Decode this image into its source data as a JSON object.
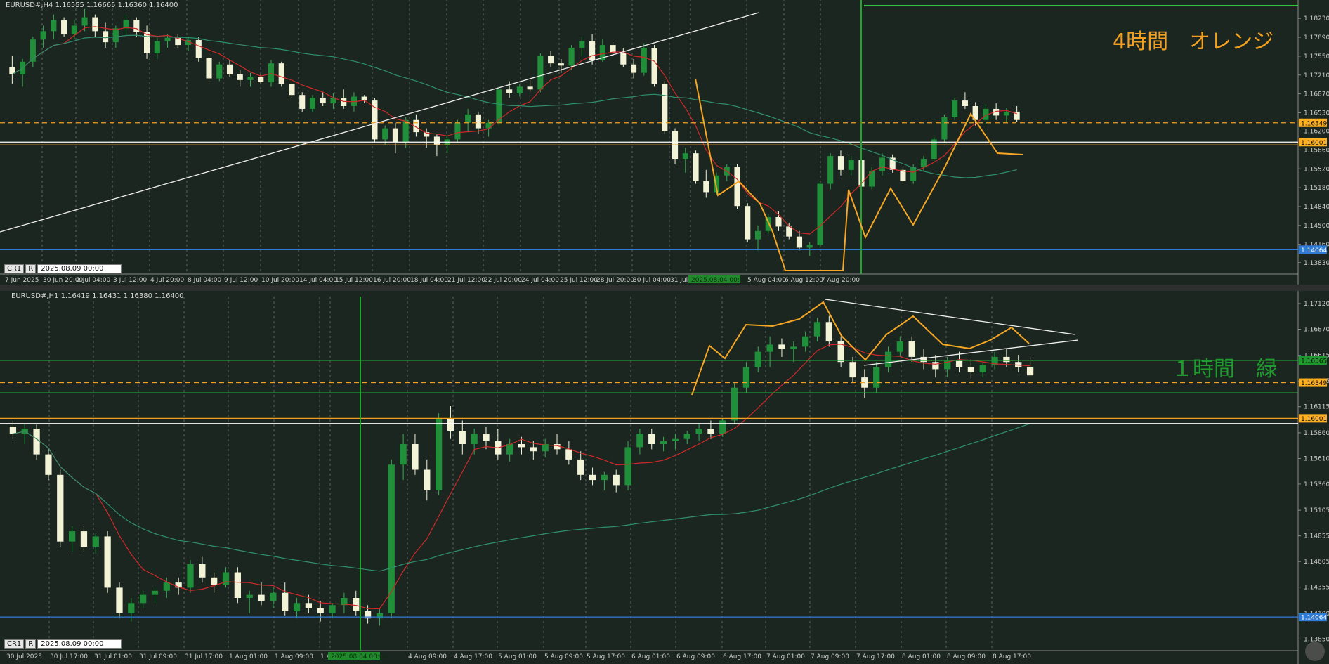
{
  "chart_data": [
    {
      "type": "candlestick",
      "symbol_header": "EURUSD#,H4  1.16555 1.16665 1.16360 1.16400",
      "title": "4時間　オレンジ",
      "cr_label": "CR1",
      "r_label": "R",
      "cursor_time": "2025.08.09 00:00",
      "x_ticks": [
        "7 Jun 2025",
        "30 Jun 20:00",
        "2 Jul 04:00",
        "3 Jul 12:00",
        "4 Jul 20:00",
        "8 Jul 04:00",
        "9 Jul 12:00",
        "10 Jul 20:00",
        "14 Jul 04:00",
        "15 Jul 12:00",
        "16 Jul 20:00",
        "18 Jul 04:00",
        "21 Jul 12:00",
        "22 Jul 20:00",
        "24 Jul 04:00",
        "25 Jul 12:00",
        "28 Jul 20:00",
        "30 Jul 04:00",
        "31 Jul 1",
        "2025.08.04 00:00",
        "5 Aug 04:00",
        "6 Aug 12:00",
        "7 Aug 20:00"
      ],
      "y_ticks": [
        "1.18230",
        "1.17890",
        "1.17550",
        "1.17210",
        "1.16870",
        "1.16530",
        "1.16200",
        "1.15860",
        "1.15520",
        "1.15180",
        "1.14840",
        "1.14500",
        "1.14160",
        "1.13830"
      ],
      "price_badges": [
        "1.16349",
        "1.16001",
        "1.14064"
      ],
      "ylim": [
        1.1365,
        1.1846
      ],
      "levels": [
        1.16349,
        1.16001,
        1.1595,
        1.14064
      ],
      "ohlc": [
        [
          1.1735,
          1.1755,
          1.1705,
          1.1722
        ],
        [
          1.1722,
          1.175,
          1.17,
          1.1745
        ],
        [
          1.1745,
          1.179,
          1.1735,
          1.1785
        ],
        [
          1.1785,
          1.181,
          1.177,
          1.18
        ],
        [
          1.18,
          1.183,
          1.1785,
          1.182
        ],
        [
          1.182,
          1.1825,
          1.179,
          1.1795
        ],
        [
          1.1795,
          1.182,
          1.1785,
          1.181
        ],
        [
          1.181,
          1.184,
          1.18,
          1.1825
        ],
        [
          1.1825,
          1.183,
          1.179,
          1.18
        ],
        [
          1.18,
          1.1815,
          1.177,
          1.178
        ],
        [
          1.178,
          1.181,
          1.177,
          1.1805
        ],
        [
          1.1805,
          1.183,
          1.1795,
          1.182
        ],
        [
          1.182,
          1.1825,
          1.179,
          1.1798
        ],
        [
          1.1798,
          1.181,
          1.175,
          1.176
        ],
        [
          1.176,
          1.179,
          1.175,
          1.1782
        ],
        [
          1.1782,
          1.1795,
          1.177,
          1.1788
        ],
        [
          1.1788,
          1.1795,
          1.177,
          1.1775
        ],
        [
          1.1775,
          1.179,
          1.1765,
          1.1784
        ],
        [
          1.1784,
          1.179,
          1.1745,
          1.1752
        ],
        [
          1.1752,
          1.176,
          1.1705,
          1.1715
        ],
        [
          1.1715,
          1.1745,
          1.171,
          1.174
        ],
        [
          1.174,
          1.1748,
          1.1718,
          1.1722
        ],
        [
          1.1722,
          1.173,
          1.17,
          1.1712
        ],
        [
          1.1712,
          1.1725,
          1.17,
          1.1718
        ],
        [
          1.1718,
          1.1722,
          1.1705,
          1.1708
        ],
        [
          1.1708,
          1.1748,
          1.17,
          1.1742
        ],
        [
          1.1742,
          1.1745,
          1.17,
          1.1705
        ],
        [
          1.1705,
          1.1712,
          1.168,
          1.1685
        ],
        [
          1.1685,
          1.169,
          1.1655,
          1.166
        ],
        [
          1.166,
          1.1685,
          1.1655,
          1.168
        ],
        [
          1.168,
          1.169,
          1.1665,
          1.167
        ],
        [
          1.167,
          1.1688,
          1.166,
          1.168
        ],
        [
          1.168,
          1.1695,
          1.166,
          1.1665
        ],
        [
          1.1665,
          1.169,
          1.1655,
          1.1682
        ],
        [
          1.1682,
          1.1685,
          1.167,
          1.1675
        ],
        [
          1.1675,
          1.168,
          1.16,
          1.1605
        ],
        [
          1.1605,
          1.163,
          1.1595,
          1.1625
        ],
        [
          1.1625,
          1.1635,
          1.158,
          1.16
        ],
        [
          1.16,
          1.1645,
          1.159,
          1.164
        ],
        [
          1.164,
          1.165,
          1.161,
          1.1618
        ],
        [
          1.1618,
          1.1625,
          1.159,
          1.161
        ],
        [
          1.161,
          1.1615,
          1.1575,
          1.1595
        ],
        [
          1.1595,
          1.161,
          1.158,
          1.1605
        ],
        [
          1.1605,
          1.164,
          1.16,
          1.1635
        ],
        [
          1.1635,
          1.166,
          1.162,
          1.165
        ],
        [
          1.165,
          1.1655,
          1.1615,
          1.1625
        ],
        [
          1.1625,
          1.164,
          1.161,
          1.1635
        ],
        [
          1.1635,
          1.17,
          1.163,
          1.1695
        ],
        [
          1.1695,
          1.171,
          1.168,
          1.1688
        ],
        [
          1.1688,
          1.1705,
          1.1682,
          1.17
        ],
        [
          1.17,
          1.1712,
          1.169,
          1.1695
        ],
        [
          1.1695,
          1.176,
          1.169,
          1.1755
        ],
        [
          1.1755,
          1.1765,
          1.1735,
          1.1742
        ],
        [
          1.1742,
          1.175,
          1.1725,
          1.1738
        ],
        [
          1.1738,
          1.1775,
          1.173,
          1.177
        ],
        [
          1.177,
          1.179,
          1.1755,
          1.1782
        ],
        [
          1.1782,
          1.1795,
          1.174,
          1.1748
        ],
        [
          1.1748,
          1.1785,
          1.1745,
          1.1775
        ],
        [
          1.1775,
          1.178,
          1.1755,
          1.176
        ],
        [
          1.176,
          1.177,
          1.1735,
          1.174
        ],
        [
          1.174,
          1.175,
          1.1715,
          1.1725
        ],
        [
          1.1725,
          1.1778,
          1.172,
          1.177
        ],
        [
          1.177,
          1.1775,
          1.17,
          1.1705
        ],
        [
          1.1705,
          1.171,
          1.1615,
          1.162
        ],
        [
          1.162,
          1.1625,
          1.156,
          1.157
        ],
        [
          1.157,
          1.159,
          1.1545,
          1.158
        ],
        [
          1.158,
          1.1585,
          1.1525,
          1.153
        ],
        [
          1.153,
          1.155,
          1.15,
          1.151
        ],
        [
          1.151,
          1.1545,
          1.1505,
          1.154
        ],
        [
          1.154,
          1.156,
          1.153,
          1.1555
        ],
        [
          1.1555,
          1.156,
          1.148,
          1.1485
        ],
        [
          1.1485,
          1.149,
          1.142,
          1.1425
        ],
        [
          1.1425,
          1.145,
          1.1405,
          1.144
        ],
        [
          1.144,
          1.147,
          1.1435,
          1.1465
        ],
        [
          1.1465,
          1.1475,
          1.144,
          1.1448
        ],
        [
          1.1448,
          1.1455,
          1.1425,
          1.143
        ],
        [
          1.143,
          1.144,
          1.1405,
          1.141
        ],
        [
          1.141,
          1.142,
          1.1395,
          1.1415
        ],
        [
          1.1415,
          1.153,
          1.141,
          1.1525
        ],
        [
          1.1525,
          1.158,
          1.1515,
          1.1575
        ],
        [
          1.1575,
          1.1585,
          1.154,
          1.155
        ],
        [
          1.155,
          1.1575,
          1.154,
          1.1568
        ],
        [
          1.1568,
          1.1572,
          1.1515,
          1.152
        ],
        [
          1.152,
          1.1555,
          1.1515,
          1.1548
        ],
        [
          1.1548,
          1.158,
          1.154,
          1.1572
        ],
        [
          1.1572,
          1.1578,
          1.1545,
          1.155
        ],
        [
          1.155,
          1.1555,
          1.1525,
          1.153
        ],
        [
          1.153,
          1.156,
          1.1525,
          1.1555
        ],
        [
          1.1555,
          1.1575,
          1.1548,
          1.157
        ],
        [
          1.157,
          1.161,
          1.1565,
          1.1605
        ],
        [
          1.1605,
          1.165,
          1.1598,
          1.1645
        ],
        [
          1.1645,
          1.168,
          1.164,
          1.1675
        ],
        [
          1.1675,
          1.169,
          1.166,
          1.1665
        ],
        [
          1.1665,
          1.1672,
          1.163,
          1.164
        ],
        [
          1.164,
          1.1668,
          1.1632,
          1.166
        ],
        [
          1.166,
          1.167,
          1.164,
          1.1648
        ],
        [
          1.1648,
          1.1662,
          1.1635,
          1.1655
        ],
        [
          1.1655,
          1.1665,
          1.1636,
          1.164
        ]
      ]
    },
    {
      "type": "candlestick",
      "symbol_header": "EURUSD#,H1  1.16419 1.16431 1.16380 1.16400",
      "title": "１時間　緑",
      "cr_label": "CR1",
      "r_label": "R",
      "cursor_time": "2025.08.09 00:00",
      "x_ticks": [
        "30 Jul 2025",
        "30 Jul 17:00",
        "31 Jul 01:00",
        "31 Jul 09:00",
        "31 Jul 17:00",
        "1 Aug 01:00",
        "1 Aug 09:00",
        "1 A",
        "2025.08.04 00:00",
        "4 Aug 09:00",
        "4 Aug 17:00",
        "5 Aug 01:00",
        "5 Aug 09:00",
        "5 Aug 17:00",
        "6 Aug 01:00",
        "6 Aug 09:00",
        "6 Aug 17:00",
        "7 Aug 01:00",
        "7 Aug 09:00",
        "7 Aug 17:00",
        "8 Aug 01:00",
        "8 Aug 09:00",
        "8 Aug 17:00"
      ],
      "y_ticks": [
        "1.17120",
        "1.16870",
        "1.16615",
        "1.16365",
        "1.16115",
        "1.15860",
        "1.15610",
        "1.15360",
        "1.15105",
        "1.14855",
        "1.14605",
        "1.14355",
        "1.14100",
        "1.13850"
      ],
      "price_badges": [
        "1.16565",
        "1.16349",
        "1.16001",
        "1.14064"
      ],
      "ylim": [
        1.1375,
        1.1712
      ],
      "levels": [
        1.16565,
        1.16349,
        1.1625,
        1.16001,
        1.1595,
        1.14064
      ],
      "ohlc": [
        [
          1.1592,
          1.1598,
          1.158,
          1.1585
        ],
        [
          1.1585,
          1.1595,
          1.1575,
          1.159
        ],
        [
          1.159,
          1.1594,
          1.156,
          1.1565
        ],
        [
          1.1565,
          1.157,
          1.154,
          1.1545
        ],
        [
          1.1545,
          1.155,
          1.1475,
          1.148
        ],
        [
          1.148,
          1.1495,
          1.147,
          1.149
        ],
        [
          1.149,
          1.1495,
          1.147,
          1.1475
        ],
        [
          1.1475,
          1.1488,
          1.1468,
          1.1485
        ],
        [
          1.1485,
          1.149,
          1.143,
          1.1435
        ],
        [
          1.1435,
          1.144,
          1.1405,
          1.141
        ],
        [
          1.141,
          1.1425,
          1.1402,
          1.142
        ],
        [
          1.142,
          1.1432,
          1.1415,
          1.1428
        ],
        [
          1.1428,
          1.1435,
          1.142,
          1.1432
        ],
        [
          1.1432,
          1.1445,
          1.1425,
          1.144
        ],
        [
          1.144,
          1.1445,
          1.1428,
          1.1435
        ],
        [
          1.1435,
          1.1462,
          1.143,
          1.1458
        ],
        [
          1.1458,
          1.1465,
          1.144,
          1.1445
        ],
        [
          1.1445,
          1.145,
          1.143,
          1.1438
        ],
        [
          1.1438,
          1.1455,
          1.1435,
          1.145
        ],
        [
          1.145,
          1.1455,
          1.142,
          1.1425
        ],
        [
          1.1425,
          1.1432,
          1.141,
          1.1428
        ],
        [
          1.1428,
          1.144,
          1.1418,
          1.1422
        ],
        [
          1.1422,
          1.1435,
          1.1415,
          1.143
        ],
        [
          1.143,
          1.144,
          1.1408,
          1.1412
        ],
        [
          1.1412,
          1.1425,
          1.1405,
          1.142
        ],
        [
          1.142,
          1.1428,
          1.141,
          1.1415
        ],
        [
          1.1415,
          1.1422,
          1.1402,
          1.141
        ],
        [
          1.141,
          1.142,
          1.1405,
          1.1418
        ],
        [
          1.1418,
          1.143,
          1.141,
          1.1425
        ],
        [
          1.1425,
          1.1432,
          1.1408,
          1.1412
        ],
        [
          1.1412,
          1.1418,
          1.14,
          1.1405
        ],
        [
          1.1405,
          1.1415,
          1.1398,
          1.141
        ],
        [
          1.141,
          1.156,
          1.1405,
          1.1555
        ],
        [
          1.1555,
          1.1585,
          1.154,
          1.1575
        ],
        [
          1.1575,
          1.1585,
          1.1545,
          1.155
        ],
        [
          1.155,
          1.156,
          1.152,
          1.153
        ],
        [
          1.153,
          1.1605,
          1.1525,
          1.16
        ],
        [
          1.16,
          1.1612,
          1.158,
          1.1588
        ],
        [
          1.1588,
          1.1598,
          1.1565,
          1.1575
        ],
        [
          1.1575,
          1.159,
          1.1565,
          1.1585
        ],
        [
          1.1585,
          1.1592,
          1.157,
          1.1578
        ],
        [
          1.1578,
          1.159,
          1.156,
          1.1565
        ],
        [
          1.1565,
          1.158,
          1.1558,
          1.1575
        ],
        [
          1.1575,
          1.1582,
          1.1565,
          1.1572
        ],
        [
          1.1572,
          1.1578,
          1.156,
          1.1568
        ],
        [
          1.1568,
          1.158,
          1.1562,
          1.1575
        ],
        [
          1.1575,
          1.1585,
          1.1565,
          1.157
        ],
        [
          1.157,
          1.1578,
          1.1555,
          1.156
        ],
        [
          1.156,
          1.1568,
          1.154,
          1.1545
        ],
        [
          1.1545,
          1.1552,
          1.1535,
          1.154
        ],
        [
          1.154,
          1.1548,
          1.153,
          1.1545
        ],
        [
          1.1545,
          1.155,
          1.1528,
          1.1535
        ],
        [
          1.1535,
          1.1578,
          1.153,
          1.1572
        ],
        [
          1.1572,
          1.159,
          1.1565,
          1.1585
        ],
        [
          1.1585,
          1.159,
          1.157,
          1.1575
        ],
        [
          1.1575,
          1.1582,
          1.1568,
          1.1578
        ],
        [
          1.1578,
          1.1585,
          1.157,
          1.158
        ],
        [
          1.158,
          1.1588,
          1.1575,
          1.1585
        ],
        [
          1.1585,
          1.1595,
          1.1578,
          1.159
        ],
        [
          1.159,
          1.1598,
          1.158,
          1.1585
        ],
        [
          1.1585,
          1.16,
          1.1582,
          1.1598
        ],
        [
          1.1598,
          1.1635,
          1.1595,
          1.163
        ],
        [
          1.163,
          1.1655,
          1.1625,
          1.165
        ],
        [
          1.165,
          1.167,
          1.1645,
          1.1665
        ],
        [
          1.1665,
          1.168,
          1.165,
          1.1672
        ],
        [
          1.1672,
          1.1678,
          1.166,
          1.1668
        ],
        [
          1.1668,
          1.1675,
          1.1655,
          1.167
        ],
        [
          1.167,
          1.1685,
          1.1665,
          1.168
        ],
        [
          1.168,
          1.1698,
          1.1675,
          1.1694
        ],
        [
          1.1694,
          1.17,
          1.167,
          1.1675
        ],
        [
          1.1675,
          1.168,
          1.165,
          1.1655
        ],
        [
          1.1655,
          1.166,
          1.1635,
          1.164
        ],
        [
          1.164,
          1.1648,
          1.162,
          1.163
        ],
        [
          1.163,
          1.1655,
          1.1625,
          1.165
        ],
        [
          1.165,
          1.167,
          1.1645,
          1.1665
        ],
        [
          1.1665,
          1.168,
          1.166,
          1.1675
        ],
        [
          1.1675,
          1.168,
          1.1655,
          1.166
        ],
        [
          1.166,
          1.1668,
          1.1648,
          1.1655
        ],
        [
          1.1655,
          1.1662,
          1.164,
          1.1648
        ],
        [
          1.1648,
          1.166,
          1.164,
          1.1656
        ],
        [
          1.1656,
          1.1665,
          1.1645,
          1.165
        ],
        [
          1.165,
          1.1658,
          1.1638,
          1.1645
        ],
        [
          1.1645,
          1.1655,
          1.164,
          1.1652
        ],
        [
          1.1652,
          1.1665,
          1.1648,
          1.166
        ],
        [
          1.166,
          1.1668,
          1.165,
          1.1655
        ],
        [
          1.1655,
          1.1662,
          1.1645,
          1.165
        ],
        [
          1.165,
          1.166,
          1.1643,
          1.1642
        ]
      ]
    }
  ]
}
